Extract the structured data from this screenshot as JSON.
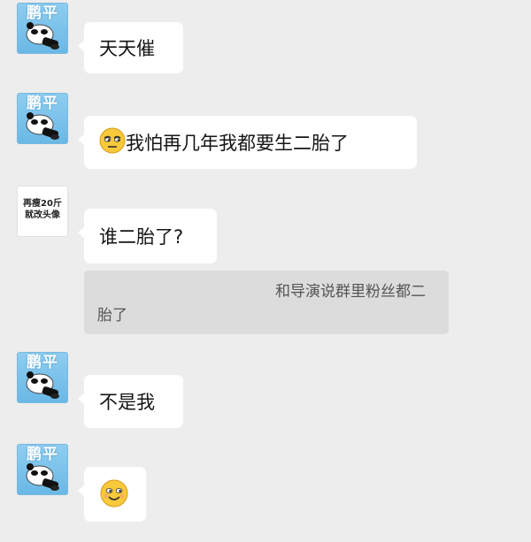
{
  "theme": {
    "background": "#ededed",
    "bubble": "#ffffff",
    "quote_background": "#dcdcdc",
    "avatar_blue": "#79c0ea"
  },
  "contacts": {
    "pengping": {
      "avatar_text": "鹏平",
      "avatar_icon": "panda-icon"
    },
    "other": {
      "avatar_text": "再瘦20斤\n就改头像"
    }
  },
  "messages": [
    {
      "sender": "鹏平",
      "text": "天天催"
    },
    {
      "sender": "鹏平",
      "emoji": "unamused-face",
      "text": "我怕再几年我都要生二胎了"
    },
    {
      "sender": "再瘦20斤就改头像",
      "text": "谁二胎了?"
    },
    {
      "quote": "和导演说群里粉丝都二胎了",
      "quote_line1": "和导演说群里粉丝都二",
      "quote_line2": "胎了"
    },
    {
      "sender": "鹏平",
      "text": "不是我"
    },
    {
      "sender": "鹏平",
      "emoji": "smiling-face"
    }
  ]
}
